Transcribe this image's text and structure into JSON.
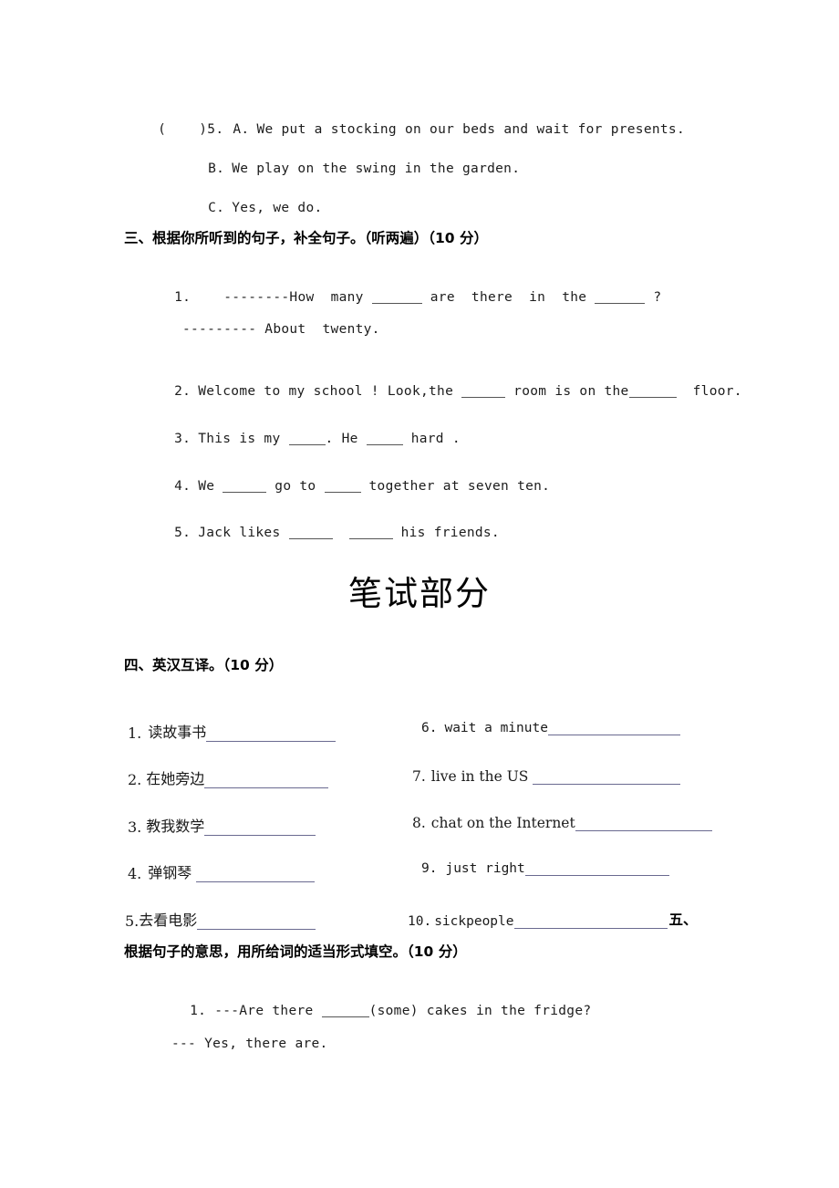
{
  "document": {
    "listening_part_tail": {
      "question_marker": "(    )5.",
      "options": [
        {
          "label": "A.",
          "text": "We put a stocking on our beds and wait for presents."
        },
        {
          "label": "B.",
          "text": "We play on the swing in the garden."
        },
        {
          "label": "C.",
          "text": "Yes, we do."
        }
      ]
    },
    "section_three": {
      "heading": "三、根据你所听到的句子，补全句子。（听两遍）（10 分）",
      "items": [
        {
          "number": "1.",
          "line1_pre": "--------How  many ",
          "line1_mid": " are  there  in  the ",
          "line1_post": " ?",
          "line2": "--------- About  twenty."
        },
        {
          "number": "2.",
          "pre": "Welcome to my school ! Look,the ",
          "mid": " room is on the",
          "post": "  floor."
        },
        {
          "number": "3.",
          "pre": "This is my ",
          "mid": ". He ",
          "post": " hard ."
        },
        {
          "number": "4.",
          "pre": "We ",
          "mid": " go to ",
          "post": " together at seven ten."
        },
        {
          "number": "5.",
          "pre": "Jack likes ",
          "mid": "  ",
          "post": " his friends."
        }
      ]
    },
    "written_part_title": "笔试部分",
    "section_four": {
      "heading": "四、英汉互译。（10 分）",
      "left_items": [
        {
          "number": "1.",
          "text": "读故事书"
        },
        {
          "number": "2.",
          "text": "在她旁边"
        },
        {
          "number": "3.",
          "text": "教我数学"
        },
        {
          "number": "4.",
          "text": "弹钢琴 "
        },
        {
          "number": "5.",
          "text": "去看电影"
        }
      ],
      "right_items": [
        {
          "number": "6.",
          "text": "wait a minute"
        },
        {
          "number": "7.",
          "text": "live in the US "
        },
        {
          "number": "8.",
          "text": "chat on the Internet"
        },
        {
          "number": "9.",
          "text": "just right"
        },
        {
          "number": "10.",
          "text": "sickpeople"
        }
      ],
      "trailing_marker": "五、"
    },
    "section_five": {
      "heading": "根据句子的意思，用所给词的适当形式填空。（10 分）",
      "items": [
        {
          "number": "1.",
          "pre": "---Are there ",
          "post": "(some) cakes in the fridge?",
          "answer_line": "--- Yes, there are."
        }
      ]
    }
  }
}
